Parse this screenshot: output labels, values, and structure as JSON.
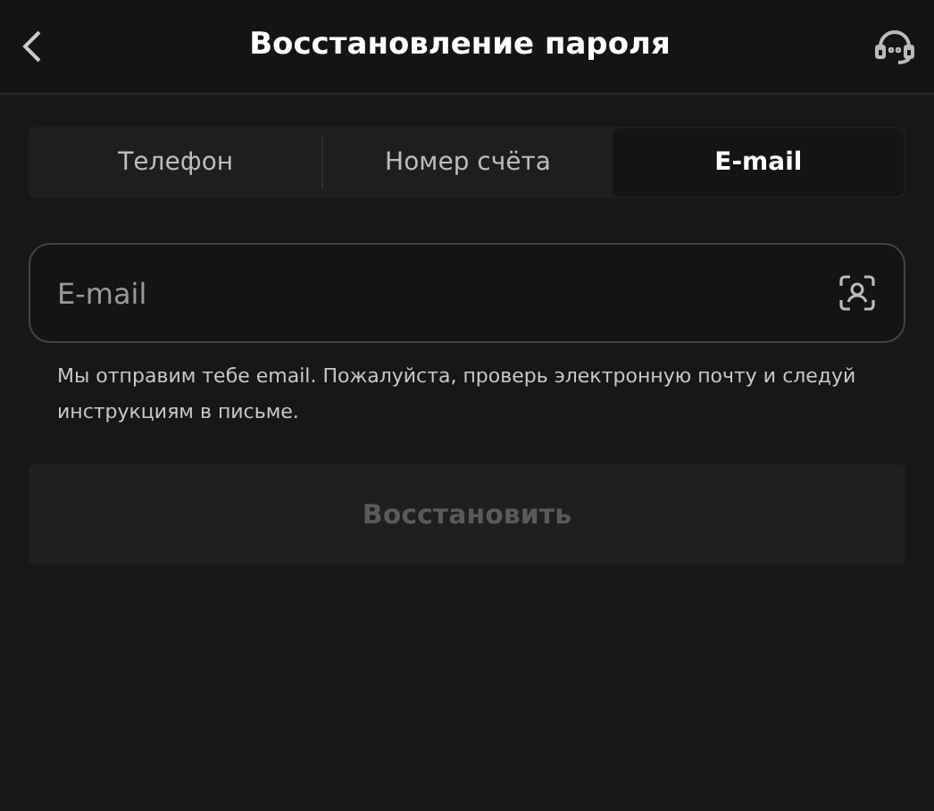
{
  "header": {
    "title": "Восстановление пароля"
  },
  "tabs": [
    {
      "label": "Телефон",
      "selected": false
    },
    {
      "label": "Номер счёта",
      "selected": false
    },
    {
      "label": "E-mail",
      "selected": true
    }
  ],
  "email_field": {
    "placeholder": "E-mail"
  },
  "hint": "Мы отправим тебе email. Пожалуйста, проверь электронную почту и следуй инструкциям в письме.",
  "submit_button": {
    "label": "Восстановить",
    "disabled": true
  }
}
